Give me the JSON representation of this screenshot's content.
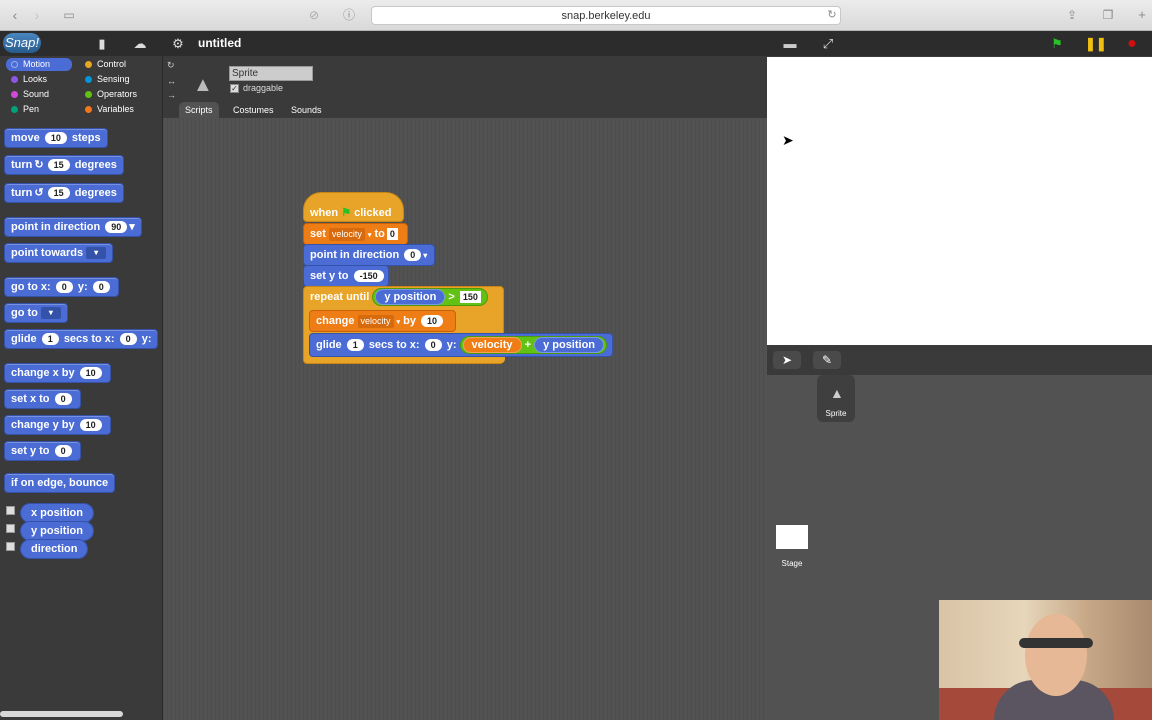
{
  "browser": {
    "url": "snap.berkeley.edu"
  },
  "app": {
    "logo": "Snap!",
    "project_name": "untitled"
  },
  "categories": [
    {
      "label": "Motion",
      "color": "#4a6cd4",
      "active": true
    },
    {
      "label": "Control",
      "color": "#e6a822"
    },
    {
      "label": "Looks",
      "color": "#8f56e3"
    },
    {
      "label": "Sensing",
      "color": "#0494dc"
    },
    {
      "label": "Sound",
      "color": "#cf4ad9"
    },
    {
      "label": "Operators",
      "color": "#62c213"
    },
    {
      "label": "Pen",
      "color": "#00a178"
    },
    {
      "label": "Variables",
      "color": "#f3761d"
    }
  ],
  "palette": {
    "move": "move",
    "move_val": "10",
    "steps": "steps",
    "turn": "turn",
    "turn_cw_val": "15",
    "degrees": "degrees",
    "turn_ccw_val": "15",
    "point_dir": "point in direction",
    "point_dir_val": "90",
    "point_towards": "point towards",
    "goto_xy": "go to x:",
    "goto_x_val": "0",
    "y_label": "y:",
    "goto_y_val": "0",
    "goto": "go to",
    "glide": "glide",
    "glide_val": "1",
    "glide_secs": "secs to x:",
    "glide_x_val": "0",
    "glide_y_label": "y:",
    "change_x": "change x by",
    "change_x_val": "10",
    "set_x": "set x to",
    "set_x_val": "0",
    "change_y": "change y by",
    "change_y_val": "10",
    "set_y": "set y to",
    "set_y_val": "0",
    "bounce": "if on edge, bounce",
    "rep_x": "x position",
    "rep_y": "y position",
    "rep_dir": "direction"
  },
  "sprite": {
    "name": "Sprite",
    "draggable": "draggable"
  },
  "tabs": [
    "Scripts",
    "Costumes",
    "Sounds"
  ],
  "script": {
    "when": "when",
    "clicked": "clicked",
    "set": "set",
    "var": "velocity",
    "to": "to",
    "set_val": "0",
    "point_dir": "point in direction",
    "point_val": "0",
    "set_y": "set y to",
    "set_y_val": "-150",
    "repeat_until": "repeat until",
    "cond_rep": "y position",
    "op_gt": ">",
    "cond_val": "150",
    "change": "change",
    "change_var": "velocity",
    "by": "by",
    "change_val": "10",
    "glide": "glide",
    "glide_val": "1",
    "secs_to_x": "secs to x:",
    "glide_x": "0",
    "y": "y:",
    "sum_a": "velocity",
    "plus": "+",
    "sum_b": "y position"
  },
  "corral": {
    "sprite_label": "Sprite",
    "stage_label": "Stage"
  }
}
